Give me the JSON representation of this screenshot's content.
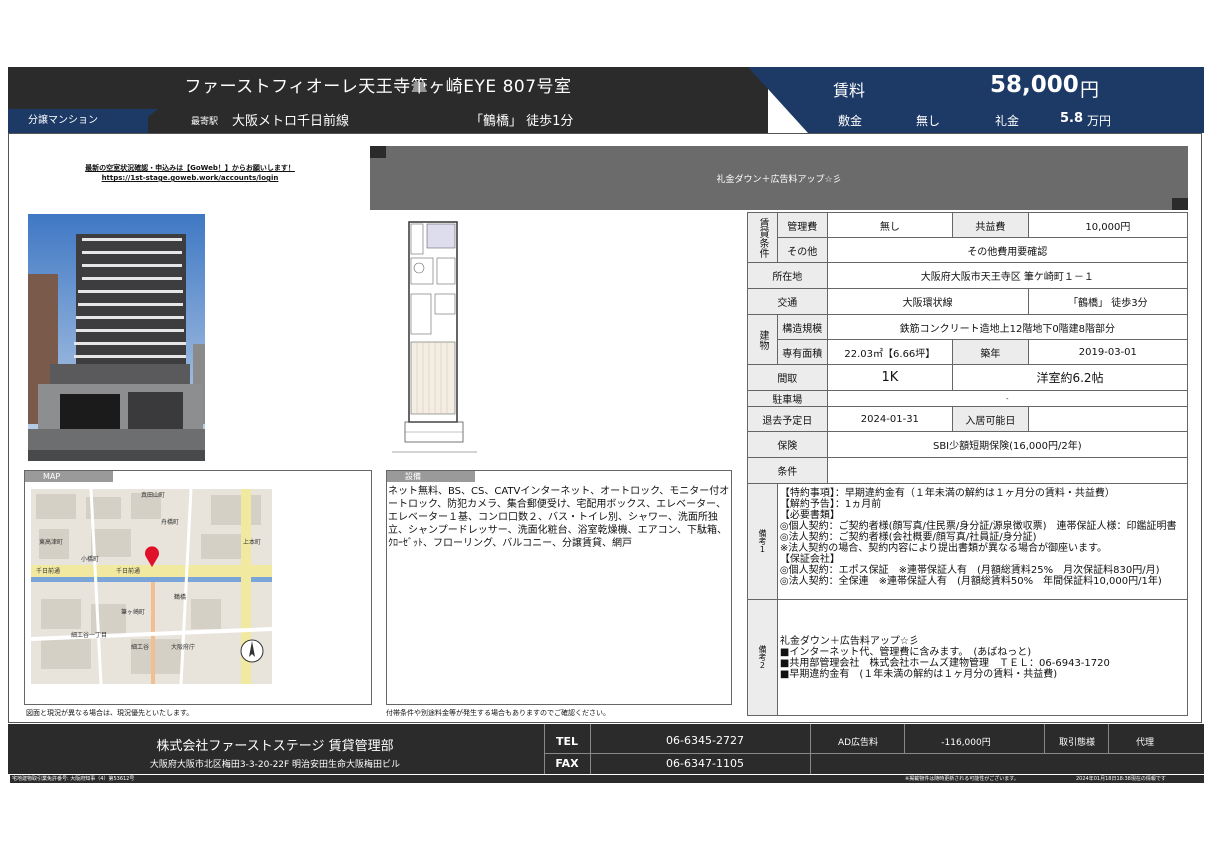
{
  "header": {
    "title": "ファーストフィオーレ天王寺筆ヶ崎EYE 807号室",
    "type": "分譲マンション",
    "station_label": "最寄駅",
    "line": "大阪メトロ千日前線",
    "walk": "「鶴橋」 徒歩1分",
    "rent_label": "賃料",
    "rent": "58,000",
    "rent_unit": "円",
    "deposit_label": "敷金",
    "deposit": "無し",
    "key_label": "礼金",
    "key_money": "5.8",
    "key_unit": "万円"
  },
  "notice": {
    "line1": "最新の空室状況確認・申込みは【GoWeb！】からお願いします！",
    "line2": "https://1st-stage.goweb.work/accounts/login"
  },
  "banner": "礼金ダウン＋広告料アップ☆彡",
  "map_label": "MAP",
  "map": {
    "labels": [
      "真田山町",
      "千日前通",
      "千日前通",
      "鶴橋",
      "東高津町",
      "小橋町",
      "上本町",
      "細工谷一丁目",
      "細工谷",
      "舟橋町",
      "大阪府庁",
      "筆ヶ崎町"
    ]
  },
  "facilities_label": "設備",
  "facilities": "ネット無料、BS、CS、CATVインターネット、オートロック、モニター付オートロック、防犯カメラ、集合郵便受け、宅配用ボックス、エレベーター、エレベーター１基、コンロ口数２、バス・トイレ別、シャワー、洗面所独立、シャンプードレッサー、洗面化粧台、浴室乾燥機、エアコン、下駄箱、ｸﾛｰｾﾞｯﾄ、フローリング、バルコニー、分譲賃貸、網戸",
  "note_map": "図面と現況が異なる場合は、現況優先といたします。",
  "note_fac": "付帯条件や別途料金等が発生する場合もありますのでご確認ください。",
  "spec": {
    "rent_terms_label": "賃貸条件",
    "mgmt_label": "管理費",
    "mgmt": "無し",
    "common_label": "共益費",
    "common": "10,000円",
    "other_label": "その他",
    "other": "その他費用要確認",
    "address_label": "所在地",
    "address": "大阪府大阪市天王寺区 筆ケ崎町１－１",
    "access_label": "交通",
    "access_line": "大阪環状線",
    "access_walk": "「鶴橋」 徒歩3分",
    "building_label": "建物",
    "structure_label": "構造規模",
    "structure": "鉄筋コンクリート造地上12階地下0階建8階部分",
    "area_label": "専有面積",
    "area": "22.03㎡【6.66坪】",
    "built_label": "築年",
    "built": "2019-03-01",
    "layout_label": "間取",
    "layout": "1K",
    "room": "洋室約6.2帖",
    "parking_label": "駐車場",
    "parking": "-",
    "moveout_label": "退去予定日",
    "moveout": "2024-01-31",
    "movein_label": "入居可能日",
    "movein": "",
    "insurance_label": "保険",
    "insurance": "SBI少額短期保険(16,000円/2年)",
    "conditions_label": "条件",
    "conditions": "",
    "remarks1_label": "備考1",
    "remarks1": [
      "【特約事項】：早期違約金有（１年未満の解約は１ヶ月分の賃料・共益費）",
      "【解約予告】：1ヵ月前",
      "【必要書類】",
      "◎個人契約：ご契約者様(顔写真/住民票/身分証/源泉徴収票)　連帯保証人様：印鑑証明書",
      "◎法人契約：ご契約者様(会社概要/顔写真/社員証/身分証)",
      "※法人契約の場合、契約内容により提出書類が異なる場合が御座います。",
      "【保証会社】",
      "◎個人契約：エポス保証　※連帯保証人有　(月額総賃料25%　月次保証料830円/月)",
      "◎法人契約：全保連　※連帯保証人有　(月額総賃料50%　年間保証料10,000円/1年)"
    ],
    "remarks2_label": "備考2",
    "remarks2": [
      "礼金ダウン＋広告料アップ☆彡",
      "■インターネット代、管理費に含みます。　(あばねっと)",
      "■共用部管理会社　株式会社ホームズ建物管理　ＴＥＬ：06-6943-1720",
      "■早期違約金有　(１年未満の解約は１ヶ月分の賃料・共益費)"
    ]
  },
  "footer": {
    "company": "株式会社ファーストステージ 賃貸管理部",
    "address": "大阪府大阪市北区梅田3-3-20-22F 明治安田生命大阪梅田ビル",
    "tel_label": "TEL",
    "tel": "06-6345-2727",
    "fax_label": "FAX",
    "fax": "06-6347-1105",
    "ad_label": "AD広告料",
    "ad": "-116,000円",
    "mode_label": "取引態様",
    "mode": "代理",
    "license": "宅地建物取引業免許番号: 大阪府知事（4）第53612号",
    "notice": "※掲載物件は随時更新される可能性がございます。",
    "date": "2024年01月18日18:38現在の情報です"
  },
  "colors": {
    "navy": "#1d3a66",
    "dark": "#2b2b2b",
    "banner": "#6b6b6b"
  }
}
